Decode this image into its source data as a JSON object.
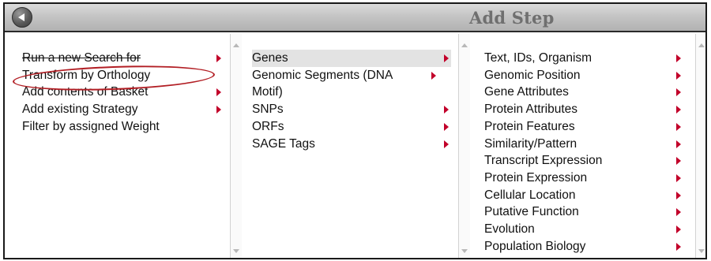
{
  "header": {
    "title": "Add Step",
    "back_icon": "back-arrow-icon"
  },
  "colors": {
    "arrow": "#c2002a",
    "highlight": "#b21e24",
    "title_text": "#6f6f6f",
    "selected_row": "#e3e3e3"
  },
  "columns": [
    {
      "items": [
        {
          "label": "Run a new Search for",
          "has_submenu": true,
          "strikethrough": true
        },
        {
          "label": "Transform by Orthology",
          "has_submenu": false,
          "circled": true
        },
        {
          "label": "Add contents of Basket",
          "has_submenu": true
        },
        {
          "label": "Add existing Strategy",
          "has_submenu": true
        },
        {
          "label": "Filter by assigned Weight",
          "has_submenu": false
        }
      ]
    },
    {
      "items": [
        {
          "label": "Genes",
          "has_submenu": true,
          "selected": true
        },
        {
          "label": "Genomic Segments (DNA Motif)",
          "has_submenu": true
        },
        {
          "label": "SNPs",
          "has_submenu": true
        },
        {
          "label": "ORFs",
          "has_submenu": true
        },
        {
          "label": "SAGE Tags",
          "has_submenu": true
        }
      ]
    },
    {
      "items": [
        {
          "label": "Text, IDs, Organism",
          "has_submenu": true
        },
        {
          "label": "Genomic Position",
          "has_submenu": true
        },
        {
          "label": "Gene Attributes",
          "has_submenu": true
        },
        {
          "label": "Protein Attributes",
          "has_submenu": true
        },
        {
          "label": "Protein Features",
          "has_submenu": true
        },
        {
          "label": "Similarity/Pattern",
          "has_submenu": true
        },
        {
          "label": "Transcript Expression",
          "has_submenu": true
        },
        {
          "label": "Protein Expression",
          "has_submenu": true
        },
        {
          "label": "Cellular Location",
          "has_submenu": true
        },
        {
          "label": "Putative Function",
          "has_submenu": true
        },
        {
          "label": "Evolution",
          "has_submenu": true
        },
        {
          "label": "Population Biology",
          "has_submenu": true
        }
      ]
    }
  ]
}
